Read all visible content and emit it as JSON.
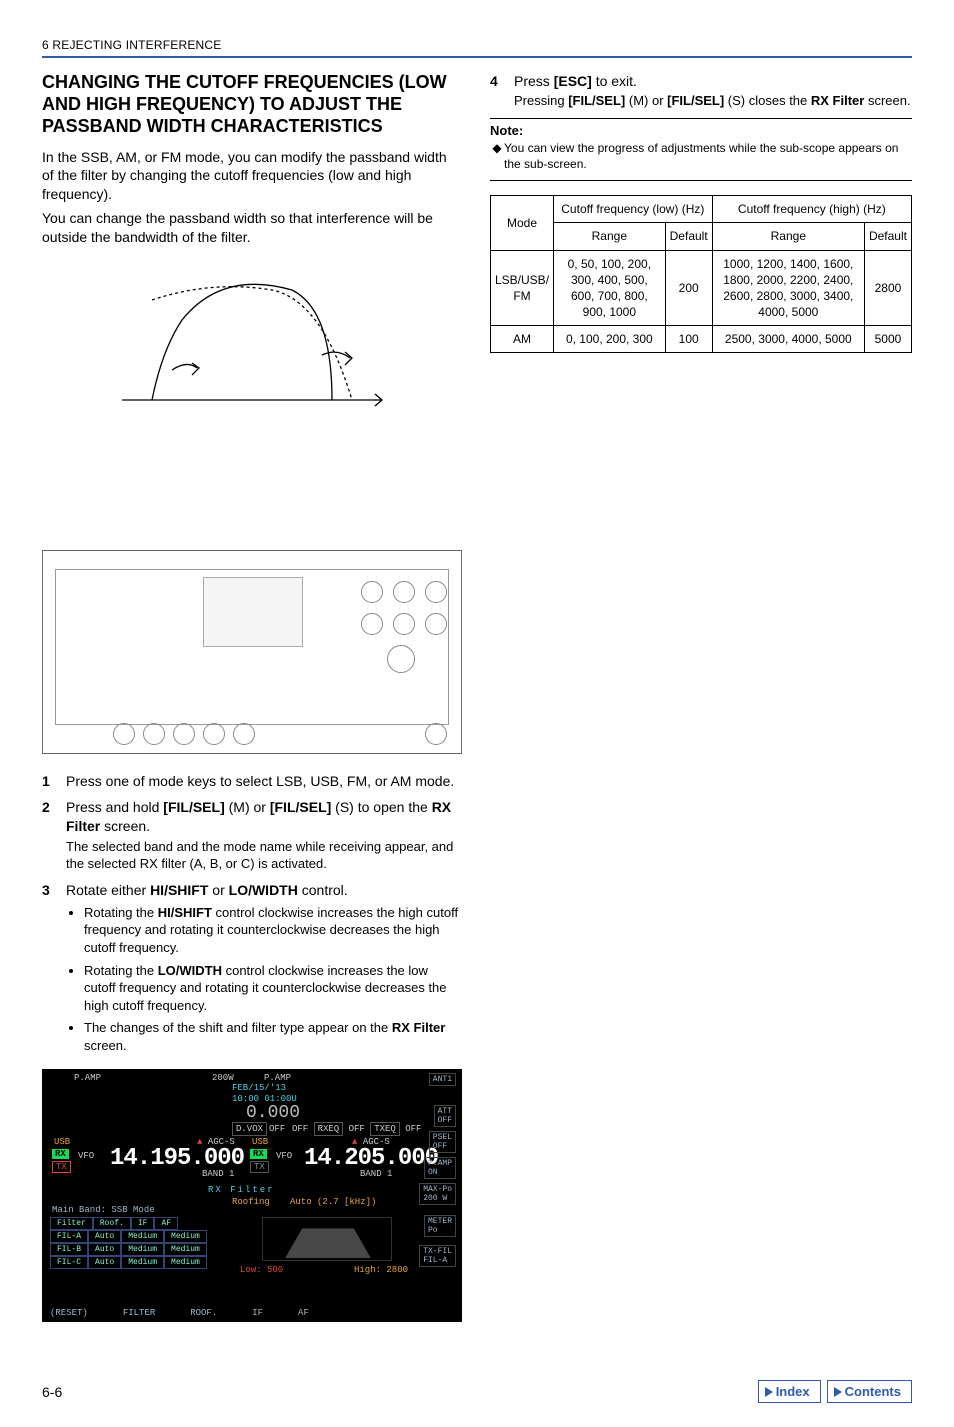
{
  "header": {
    "title": "6 REJECTING INTERFERENCE"
  },
  "section": {
    "title": "CHANGING THE CUTOFF FREQUENCIES (LOW AND HIGH FREQUENCY) TO ADJUST THE PASSBAND WIDTH CHARACTERISTICS",
    "intro1": "In the SSB, AM, or FM mode, you can modify the passband width of the filter by changing the cutoff frequencies (low and high frequency).",
    "intro2": "You can change the passband width so that interference will be outside the bandwidth of the filter."
  },
  "steps": {
    "s1": {
      "num": "1",
      "text_a": "Press one of mode keys to select LSB, USB, FM, or AM mode."
    },
    "s2": {
      "num": "2",
      "text_a": "Press and hold ",
      "key1": "[FIL/SEL]",
      "text_b": " (M) or ",
      "key2": "[FIL/SEL]",
      "text_c": " (S) to open the ",
      "bold1": "RX Filter",
      "text_d": " screen.",
      "sub": "The selected band and the mode name while receiving appear, and the selected RX filter (A, B, or C) is activated."
    },
    "s3": {
      "num": "3",
      "lead_a": "Rotate either ",
      "bold1": "HI/SHIFT",
      "lead_b": " or ",
      "bold2": "LO/WIDTH",
      "lead_c": " control.",
      "b1_a": "Rotating the ",
      "b1_bold": "HI/SHIFT",
      "b1_b": " control clockwise increases the high cutoff frequency and rotating it counterclockwise decreases the high cutoff frequency.",
      "b2_a": "Rotating the ",
      "b2_bold": "LO/WIDTH",
      "b2_b": " control clockwise increases the low cutoff frequency and rotating it counterclockwise decreases the high cutoff frequency.",
      "b3_a": "The changes of the shift and filter type appear on the ",
      "b3_bold": "RX Filter",
      "b3_b": " screen."
    },
    "s4": {
      "num": "4",
      "text_a": "Press ",
      "key1": "[ESC]",
      "text_b": " to exit.",
      "line2_a": "Pressing ",
      "line2_key1": "[FIL/SEL]",
      "line2_b": " (M) or ",
      "line2_key2": "[FIL/SEL]",
      "line2_c": " (S) closes the ",
      "line2_bold": "RX Filter",
      "line2_d": " screen."
    }
  },
  "note": {
    "label": "Note:",
    "text": "You can view the progress of adjustments while the sub-scope appears on the sub-screen."
  },
  "table": {
    "h_mode": "Mode",
    "h_low": "Cutoff frequency (low) (Hz)",
    "h_high": "Cutoff frequency (high) (Hz)",
    "h_range": "Range",
    "h_default": "Default",
    "rows": [
      {
        "mode": "LSB/USB/\nFM",
        "low_range": "0, 50, 100, 200, 300, 400, 500, 600, 700, 800, 900, 1000",
        "low_def": "200",
        "high_range": "1000, 1200, 1400, 1600, 1800, 2000, 2200, 2400, 2600, 2800, 3000, 3400, 4000, 5000",
        "high_def": "2800"
      },
      {
        "mode": "AM",
        "low_range": "0, 100, 200, 300",
        "low_def": "100",
        "high_range": "2500, 3000, 4000, 5000",
        "high_def": "5000"
      }
    ]
  },
  "screen": {
    "ant": "ANT1",
    "pamp": "P.AMP",
    "date": "FEB/15/'13",
    "time": "10:00 01:00U",
    "zero": "0.000",
    "dvox": "D.VOX",
    "off1": "OFF",
    "off2": "OFF",
    "rxeq": "RXEQ",
    "off3": "OFF",
    "txeq": "TXEQ",
    "off4": "OFF",
    "usb": "USB",
    "agcs": "AGC-S",
    "rx": "RX",
    "tx": "TX",
    "vfo": "VFO",
    "freq_m": "14.195.000",
    "freq_s": "14.205.000",
    "band1": "BAND 1",
    "band2": "BAND 1",
    "att": "ATT\nOFF",
    "psel": "PSEL\nOFF",
    "pamp2": "P.AMP\nON",
    "maxp": "MAX-Po\n200 W",
    "meter": "METER\nPo",
    "txfil": "TX-FIL\nFIL-A",
    "rxfilter": "RX Filter",
    "mainband": "Main Band: SSB Mode",
    "roofing": "Roofing",
    "auto27": "Auto (2.7 [kHz])",
    "th_filter": "Filter",
    "th_roof": "Roof.",
    "th_if": "IF",
    "th_af": "AF",
    "tr": [
      {
        "a": "FIL-A",
        "b": "Auto",
        "c": "Medium",
        "d": "Medium"
      },
      {
        "a": "FIL-B",
        "b": "Auto",
        "c": "Medium",
        "d": "Medium"
      },
      {
        "a": "FIL-C",
        "b": "Auto",
        "c": "Medium",
        "d": "Medium"
      }
    ],
    "low": "Low:  500",
    "high": "High: 2800",
    "btns": [
      "(RESET)",
      "FILTER",
      "ROOF.",
      "IF",
      "AF"
    ],
    "w200": "200W"
  },
  "footer": {
    "page": "6-6",
    "index": "Index",
    "contents": "Contents"
  }
}
